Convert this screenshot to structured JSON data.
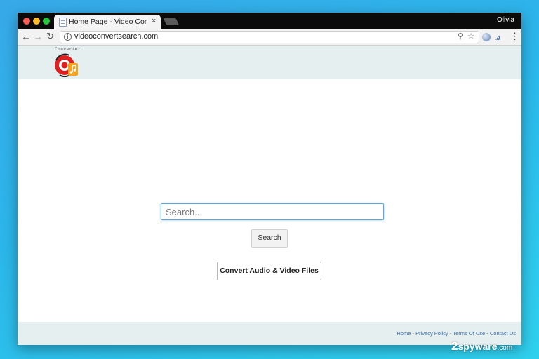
{
  "browser": {
    "tab_title": "Home Page - Video Convert Se",
    "tab_close": "×",
    "profile_name": "Olivia",
    "url": "videoconvertsearch.com"
  },
  "site": {
    "logo_text": "Converter",
    "search_placeholder": "Search...",
    "search_button": "Search",
    "convert_button": "Convert Audio & Video Files",
    "footer_links": [
      "Home",
      "Privacy Policy",
      "Terms Of Use",
      "Contact Us"
    ],
    "footer_separator": "-"
  },
  "watermark": {
    "num": "2",
    "text": "spyware",
    "suffix": ".com"
  },
  "colors": {
    "background": "#2bb6ea",
    "header_bg": "#e6eff0",
    "link": "#3a6ea5",
    "logo_red": "#e02020",
    "logo_orange": "#f7a21b"
  }
}
